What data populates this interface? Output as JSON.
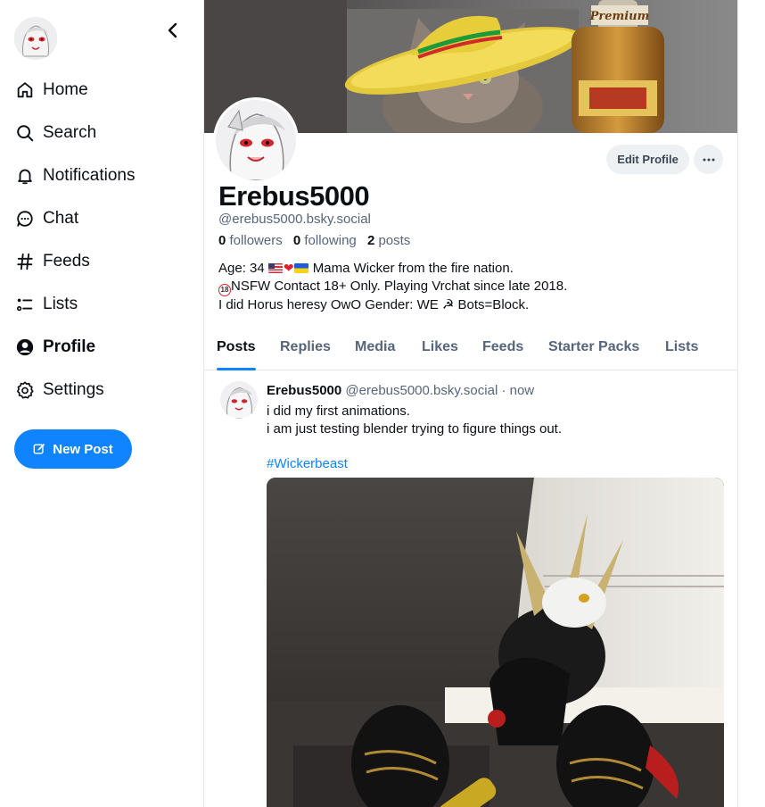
{
  "sidebar": {
    "nav": [
      {
        "label": "Home",
        "icon": "home-icon"
      },
      {
        "label": "Search",
        "icon": "search-icon"
      },
      {
        "label": "Notifications",
        "icon": "bell-icon"
      },
      {
        "label": "Chat",
        "icon": "chat-icon"
      },
      {
        "label": "Feeds",
        "icon": "hash-icon"
      },
      {
        "label": "Lists",
        "icon": "list-icon"
      },
      {
        "label": "Profile",
        "icon": "profile-icon",
        "active": true
      },
      {
        "label": "Settings",
        "icon": "gear-icon"
      }
    ],
    "new_post_label": "New Post"
  },
  "profile": {
    "edit_label": "Edit Profile",
    "display_name": "Erebus5000",
    "handle": "@erebus5000.bsky.social",
    "followers_count": "0",
    "followers_label": "followers",
    "following_count": "0",
    "following_label": "following",
    "posts_count": "2",
    "posts_label": "posts",
    "bio": {
      "line1_before": "Age: 34",
      "line1_after": "Mama Wicker from the fire nation.",
      "line2": "NSFW Contact 18+ Only. Playing Vrchat since late 2018.",
      "line3": "I did Horus heresy OwO Gender: WE ☭ Bots=Block.",
      "badge": "18"
    }
  },
  "tabs": [
    "Posts",
    "Replies",
    "Media",
    "Likes",
    "Feeds",
    "Starter Packs",
    "Lists"
  ],
  "active_tab": "Posts",
  "post": {
    "author": "Erebus5000",
    "handle": "@erebus5000.bsky.social",
    "time": "· now",
    "line1": "i did my first animations.",
    "line2": "i am just testing blender trying to figure things out.",
    "hashtag": "#Wickerbeast"
  },
  "banner": {
    "bottle_label": "Premium"
  },
  "colors": {
    "accent": "#1083fe",
    "muted": "#56657a",
    "border": "#e4e7ec"
  }
}
